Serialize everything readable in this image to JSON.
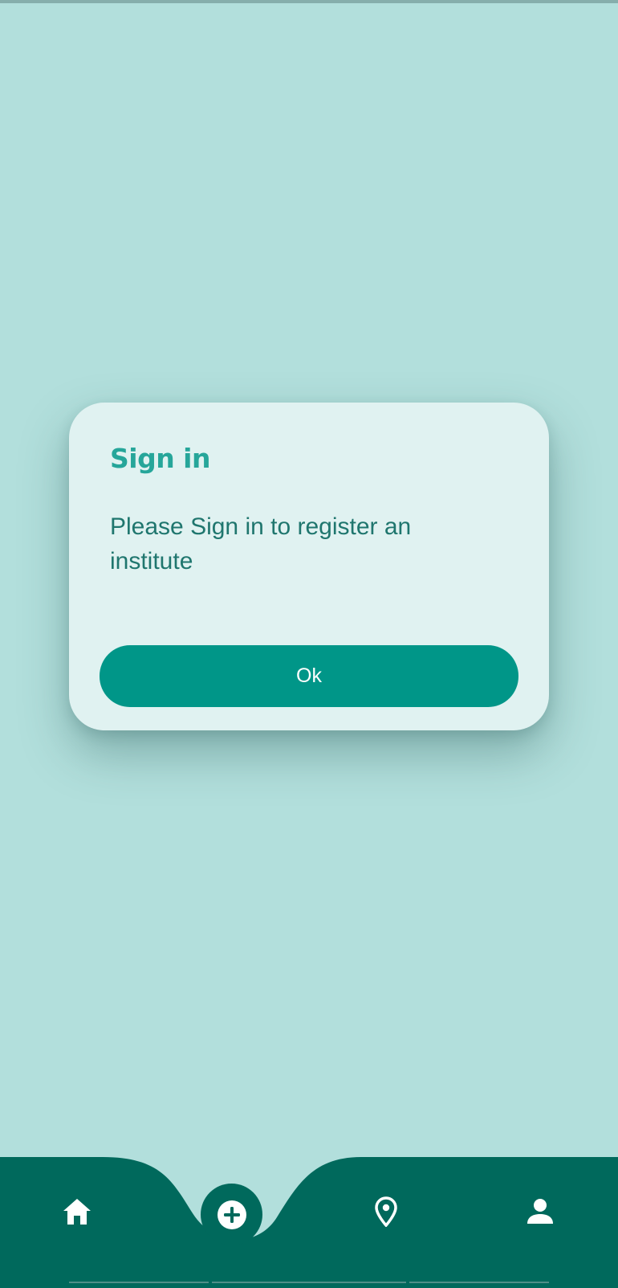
{
  "dialog": {
    "title": "Sign in",
    "message": "Please Sign in to register an institute",
    "ok_label": "Ok"
  },
  "bottom_nav": {
    "items": [
      {
        "icon": "home-icon"
      },
      {
        "icon": "add-circle-icon"
      },
      {
        "icon": "location-pin-icon"
      },
      {
        "icon": "person-icon"
      }
    ]
  },
  "colors": {
    "background": "#b2dfdc",
    "dialog_bg": "#e0f2f1",
    "title": "#26a69a",
    "message": "#1f766e",
    "button": "#009688",
    "nav_bar": "#00695c"
  }
}
